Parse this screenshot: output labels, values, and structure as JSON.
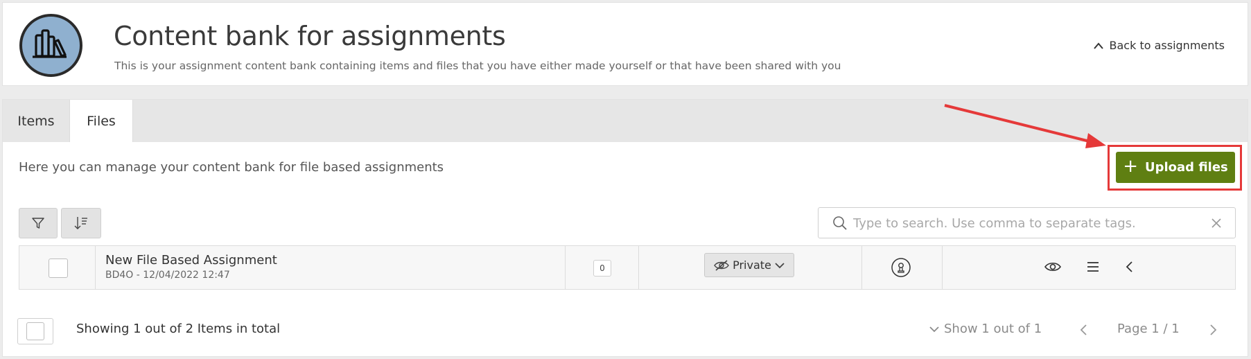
{
  "header": {
    "title": "Content bank for assignments",
    "subtitle": "This is your assignment content bank containing items and files that you have either made yourself or that have been shared with you",
    "back_label": "Back to assignments"
  },
  "tabs": [
    {
      "label": "Items",
      "active": false
    },
    {
      "label": "Files",
      "active": true
    }
  ],
  "description": "Here you can manage your content bank for file based assignments",
  "upload_button": {
    "label": "Upload files",
    "icon": "plus-icon",
    "color": "#5f7f12"
  },
  "highlight_color": "#e53939",
  "toolbar": {
    "filter_icon": "filter-icon",
    "sort_icon": "sort-icon"
  },
  "search": {
    "placeholder": "Type to search. Use comma to separate tags.",
    "value": ""
  },
  "rows": [
    {
      "title": "New File Based Assignment",
      "meta": "BD4O - 12/04/2022 12:47",
      "count": "0",
      "privacy": "Private"
    }
  ],
  "footer": {
    "showing": "Showing 1 out of 2 Items in total",
    "show_range": "Show 1 out of 1",
    "page_label": "Page 1 / 1"
  }
}
